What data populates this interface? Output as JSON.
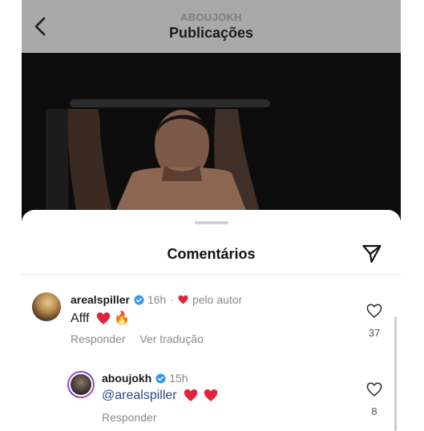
{
  "header": {
    "username": "ABOUJOKH",
    "title": "Publicações"
  },
  "sheet": {
    "title": "Comentários"
  },
  "comments": [
    {
      "username": "arealspiller",
      "time": "16h",
      "author_like": "pelo autor",
      "text": "Afff",
      "emoji": "🔥",
      "reply_label": "Responder",
      "translate_label": "Ver tradução",
      "like_count": "37"
    },
    {
      "username": "aboujokh",
      "time": "15h",
      "text": "@arealspiller",
      "reply_label": "Responder",
      "like_count": "8"
    }
  ],
  "colors": {
    "header_bg": "#a9a9a9",
    "heart_red": "#e02439",
    "verified_blue": "#3897f0",
    "mention": "#2a4a8a"
  },
  "icons": {
    "back": "chevron-left-icon",
    "send": "send-icon",
    "like": "heart-outline-icon",
    "verified": "verified-badge-icon"
  }
}
